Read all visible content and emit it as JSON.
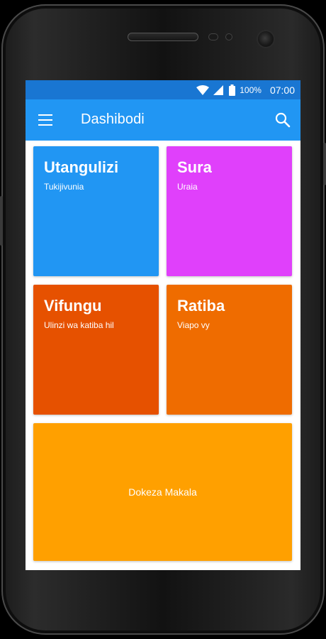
{
  "status_bar": {
    "battery_percent": "100%",
    "time": "07:00",
    "icons": [
      "wifi-icon",
      "signal-icon",
      "battery-icon"
    ]
  },
  "app_bar": {
    "title": "Dashibodi",
    "background_color": "#2196f3",
    "menu_icon": "menu-icon",
    "search_icon": "search-icon"
  },
  "tiles": [
    {
      "title": "Utangulizi",
      "subtitle": "Tukijivunia",
      "color": "#2196f3"
    },
    {
      "title": "Sura",
      "subtitle": "Uraia",
      "color": "#e040fb"
    },
    {
      "title": "Vifungu",
      "subtitle": "Ulinzi wa katiba hil",
      "color": "#e65100"
    },
    {
      "title": "Ratiba",
      "subtitle": "Viapo vy",
      "color": "#ef6c00"
    }
  ],
  "wide_tile": {
    "label": "Dokeza Makala",
    "color": "#ffa000"
  }
}
